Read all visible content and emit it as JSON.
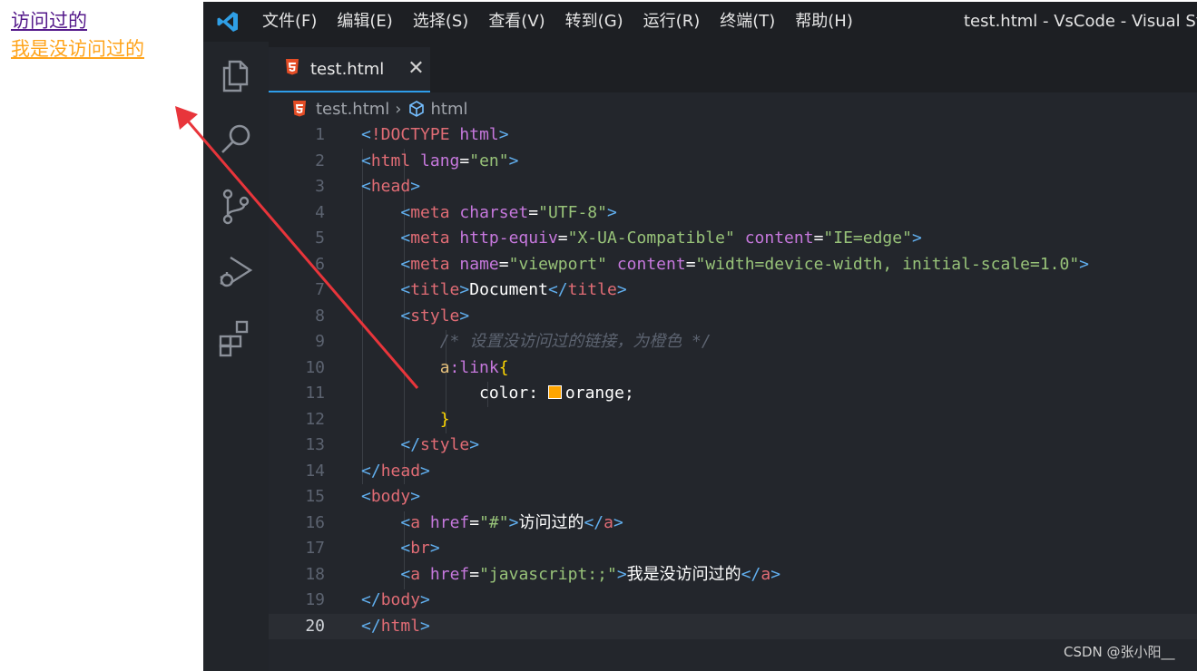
{
  "preview": {
    "link_visited": "访问过的",
    "link_unvisited": "我是没访问过的"
  },
  "titlebar": {
    "menu": [
      "文件(F)",
      "编辑(E)",
      "选择(S)",
      "查看(V)",
      "转到(G)",
      "运行(R)",
      "终端(T)",
      "帮助(H)"
    ],
    "window_title": "test.html - VsCode - Visual Studi"
  },
  "activitybar": {
    "icons": [
      "files-icon",
      "search-icon",
      "source-control-icon",
      "run-debug-icon",
      "extensions-icon"
    ]
  },
  "tab": {
    "name": "test.html",
    "close": "✕"
  },
  "breadcrumb": {
    "file": "test.html",
    "sep": "›",
    "symbol": "html"
  },
  "code": {
    "line_numbers": [
      "1",
      "2",
      "3",
      "4",
      "5",
      "6",
      "7",
      "8",
      "9",
      "10",
      "11",
      "12",
      "13",
      "14",
      "15",
      "16",
      "17",
      "18",
      "19",
      "20"
    ],
    "current_line": "20"
  },
  "watermark": "CSDN @张小阳__",
  "colors": {
    "accent_tab": "#2e9dea",
    "visited_link": "#551a8b",
    "unvisited_link": "#ffa41b",
    "arrow": "#e8353b"
  }
}
